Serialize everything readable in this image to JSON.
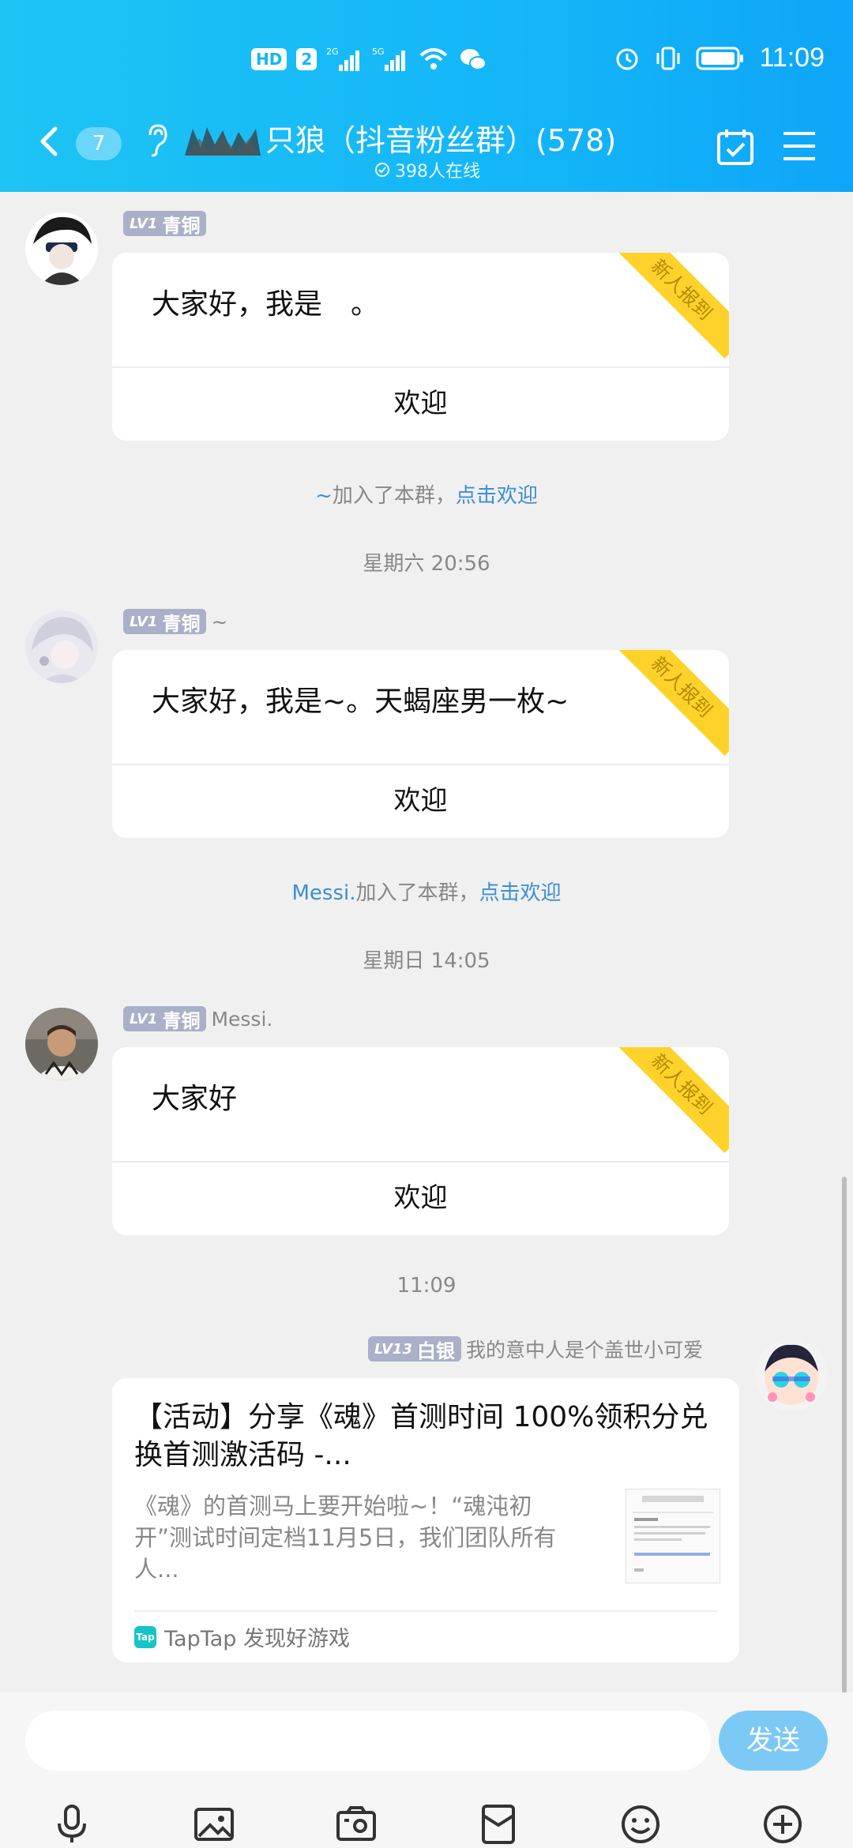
{
  "status_bar": {
    "hd_label": "HD",
    "sim_label": "2",
    "net1": "2G",
    "net2": "5G",
    "time": "11:09"
  },
  "header": {
    "unread_count": "7",
    "title": "只狼（抖音粉丝群）(578)",
    "online": "398人在线"
  },
  "messages": [
    {
      "level": "LV1",
      "rank": "青铜",
      "nickname": "",
      "text": "大家好，我是　。",
      "ribbon": "新人报到",
      "welcome": "欢迎"
    },
    {
      "level": "LV1",
      "rank": "青铜",
      "nickname": "~",
      "text": "大家好，我是~。天蝎座男一枚~",
      "ribbon": "新人报到",
      "welcome": "欢迎"
    },
    {
      "level": "LV1",
      "rank": "青铜",
      "nickname": "Messi.",
      "text": "大家好",
      "ribbon": "新人报到",
      "welcome": "欢迎"
    }
  ],
  "system": [
    {
      "name": "~",
      "text": "加入了本群，",
      "link": "点击欢迎"
    },
    {
      "time": "星期六 20:56"
    },
    {
      "name": "Messi.",
      "text": "加入了本群，",
      "link": "点击欢迎"
    },
    {
      "time": "星期日 14:05"
    },
    {
      "time": "11:09"
    }
  ],
  "self_message": {
    "level": "LV13",
    "rank": "白银",
    "nickname": "我的意中人是个盖世小可爱",
    "title": "【活动】分享《魂》首测时间 100%领积分兑换首测激活码 -...",
    "description": "《魂》的首测马上要开始啦~！“魂沌初开”测试时间定档11月5日，我们团队所有人...",
    "source": "TapTap 发现好游戏",
    "source_logo": "Tap"
  },
  "input_bar": {
    "send_label": "发送"
  }
}
